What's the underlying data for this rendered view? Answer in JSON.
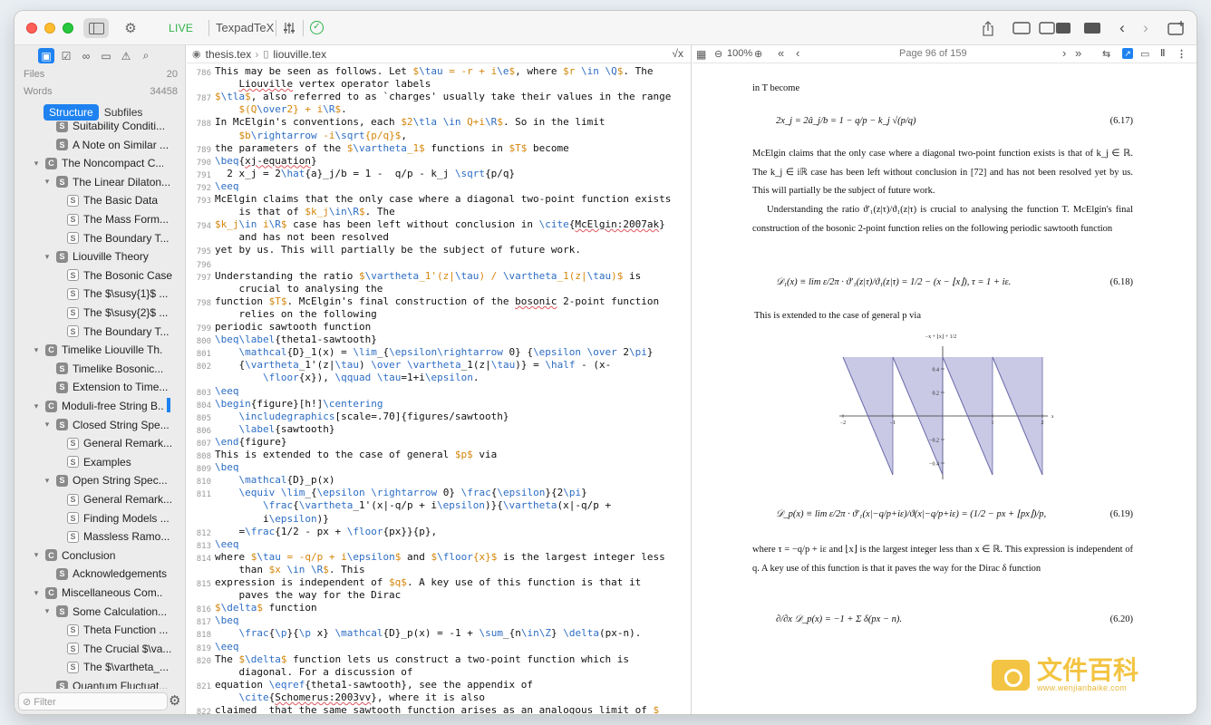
{
  "toolbar": {
    "live_label": "LIVE",
    "project_name": "TexpadTeX",
    "sidebar_toggle_icon": "sidebar-icon",
    "settings_icon": "gear-cluster-icon",
    "mixer_icon": "sliders-icon",
    "status_icon": "checkmark-circle-icon",
    "share_icon": "share-icon",
    "layout_icons": [
      "editor-only-icon",
      "split-view-icon",
      "preview-only-icon"
    ],
    "nav_back_icon": "chevron-left-icon",
    "nav_forward_icon": "chevron-right-icon",
    "new_window_icon": "new-window-icon"
  },
  "sidebar": {
    "files_label": "Files",
    "files_count": "20",
    "words_label": "Words",
    "words_count": "34458",
    "tabs": [
      "Structure",
      "Subfiles"
    ],
    "active_tab": "Structure",
    "filter_placeholder": "Filter",
    "tree": [
      {
        "label": "Suitability Conditi...",
        "badge": "S",
        "level": 2,
        "chev": "",
        "sub": false
      },
      {
        "label": "A Note on Similar ...",
        "badge": "S",
        "level": 2,
        "chev": "",
        "sub": false
      },
      {
        "label": "The Noncompact C...",
        "badge": "C",
        "level": 1,
        "chev": "▾",
        "sub": false
      },
      {
        "label": "The Linear Dilaton...",
        "badge": "S",
        "level": 2,
        "chev": "▾",
        "sub": false
      },
      {
        "label": "The Basic Data",
        "badge": "S",
        "level": 3,
        "chev": "",
        "sub": true
      },
      {
        "label": "The Mass Form...",
        "badge": "S",
        "level": 3,
        "chev": "",
        "sub": true
      },
      {
        "label": "The Boundary T...",
        "badge": "S",
        "level": 3,
        "chev": "",
        "sub": true
      },
      {
        "label": "Liouville Theory",
        "badge": "S",
        "level": 2,
        "chev": "▾",
        "sub": false
      },
      {
        "label": "The Bosonic Case",
        "badge": "S",
        "level": 3,
        "chev": "",
        "sub": true
      },
      {
        "label": "The $\\susy{1}$ ...",
        "badge": "S",
        "level": 3,
        "chev": "",
        "sub": true
      },
      {
        "label": "The $\\susy{2}$ ...",
        "badge": "S",
        "level": 3,
        "chev": "",
        "sub": true
      },
      {
        "label": "The Boundary T...",
        "badge": "S",
        "level": 3,
        "chev": "",
        "sub": true
      },
      {
        "label": "Timelike Liouville Th...",
        "badge": "C",
        "level": 1,
        "chev": "▾",
        "sub": false
      },
      {
        "label": "Timelike Bosonic...",
        "badge": "S",
        "level": 2,
        "chev": "",
        "sub": false
      },
      {
        "label": "Extension to Time...",
        "badge": "S",
        "level": 2,
        "chev": "",
        "sub": false
      },
      {
        "label": "Moduli-free String B...",
        "badge": "C",
        "level": 1,
        "chev": "▾",
        "sub": false
      },
      {
        "label": "Closed String Spe...",
        "badge": "S",
        "level": 2,
        "chev": "▾",
        "sub": false
      },
      {
        "label": "General Remark...",
        "badge": "S",
        "level": 3,
        "chev": "",
        "sub": true
      },
      {
        "label": "Examples",
        "badge": "S",
        "level": 3,
        "chev": "",
        "sub": true
      },
      {
        "label": "Open String Spec...",
        "badge": "S",
        "level": 2,
        "chev": "▾",
        "sub": false
      },
      {
        "label": "General Remark...",
        "badge": "S",
        "level": 3,
        "chev": "",
        "sub": true
      },
      {
        "label": "Finding Models ...",
        "badge": "S",
        "level": 3,
        "chev": "",
        "sub": true
      },
      {
        "label": "Massless Ramo...",
        "badge": "S",
        "level": 3,
        "chev": "",
        "sub": true
      },
      {
        "label": "Conclusion",
        "badge": "C",
        "level": 1,
        "chev": "▾",
        "sub": false
      },
      {
        "label": "Acknowledgements",
        "badge": "S",
        "level": 2,
        "chev": "",
        "sub": false
      },
      {
        "label": "Miscellaneous Com...",
        "badge": "C",
        "level": 1,
        "chev": "▾",
        "sub": false
      },
      {
        "label": "Some Calculation...",
        "badge": "S",
        "level": 2,
        "chev": "▾",
        "sub": false
      },
      {
        "label": "Theta Function ...",
        "badge": "S",
        "level": 3,
        "chev": "",
        "sub": true
      },
      {
        "label": "The Crucial $\\va...",
        "badge": "S",
        "level": 3,
        "chev": "",
        "sub": true
      },
      {
        "label": "The $\\vartheta_...",
        "badge": "S",
        "level": 3,
        "chev": "",
        "sub": true
      },
      {
        "label": "Quantum Fluctuat...",
        "badge": "S",
        "level": 2,
        "chev": "",
        "sub": false
      }
    ]
  },
  "editor": {
    "breadcrumb": [
      "thesis.tex",
      "liouville.tex"
    ],
    "math_button": "√x",
    "lines": [
      {
        "n": "786",
        "t": "This may be seen as follows. Let $\\tau = -r + i\\e$, where $r \\in \\Q$. The"
      },
      {
        "n": "",
        "t": "    Liouville vertex operator labels"
      },
      {
        "n": "787",
        "t": "$\\tla$, also referred to as `charges' usually take their values in the range"
      },
      {
        "n": "",
        "t": "    $(Q\\over2} + i\\R$."
      },
      {
        "n": "788",
        "t": "In McElgin's conventions, each $2\\tla \\in Q+i\\R$. So in the limit"
      },
      {
        "n": "",
        "t": "    $b\\rightarrow -i\\sqrt{p/q}$,"
      },
      {
        "n": "789",
        "t": "the parameters of the $\\vartheta_1$ functions in $T$ become"
      },
      {
        "n": "790",
        "t": "\\beq{xj-equation}"
      },
      {
        "n": "791",
        "t": "  2 x_j = 2\\hat{a}_j/b = 1 -  q/p - k_j \\sqrt{p/q}"
      },
      {
        "n": "792",
        "t": "\\eeq"
      },
      {
        "n": "793",
        "t": "McElgin claims that the only case where a diagonal two-point function exists"
      },
      {
        "n": "",
        "t": "    is that of $k_j\\in\\R$. The"
      },
      {
        "n": "794",
        "t": "$k_j\\in i\\R$ case has been left without conclusion in \\cite{McElgin:2007ak}"
      },
      {
        "n": "",
        "t": "    and has not been resolved"
      },
      {
        "n": "795",
        "t": "yet by us. This will partially be the subject of future work."
      },
      {
        "n": "796",
        "t": ""
      },
      {
        "n": "797",
        "t": "Understanding the ratio $\\vartheta_1'(z|\\tau) / \\vartheta_1(z|\\tau)$ is"
      },
      {
        "n": "",
        "t": "    crucial to analysing the"
      },
      {
        "n": "798",
        "t": "function $T$. McElgin's final construction of the bosonic 2-point function"
      },
      {
        "n": "",
        "t": "    relies on the following"
      },
      {
        "n": "799",
        "t": "periodic sawtooth function"
      },
      {
        "n": "800",
        "t": "\\beq\\label{theta1-sawtooth}"
      },
      {
        "n": "801",
        "t": "    \\mathcal{D}_1(x) = \\lim_{\\epsilon\\rightarrow 0} {\\epsilon \\over 2\\pi}"
      },
      {
        "n": "802",
        "t": "    {\\vartheta_1'(z|\\tau) \\over \\vartheta_1(z|\\tau)} = \\half - (x-"
      },
      {
        "n": "",
        "t": "        \\floor{x}), \\qquad \\tau=1+i\\epsilon."
      },
      {
        "n": "803",
        "t": "\\eeq"
      },
      {
        "n": "804",
        "t": "\\begin{figure}[h!]\\centering"
      },
      {
        "n": "805",
        "t": "    \\includegraphics[scale=.70]{figures/sawtooth}"
      },
      {
        "n": "806",
        "t": "    \\label{sawtooth}"
      },
      {
        "n": "807",
        "t": "\\end{figure}"
      },
      {
        "n": "808",
        "t": "This is extended to the case of general $p$ via"
      },
      {
        "n": "809",
        "t": "\\beq"
      },
      {
        "n": "810",
        "t": "    \\mathcal{D}_p(x)"
      },
      {
        "n": "811",
        "t": "    \\equiv \\lim_{\\epsilon \\rightarrow 0} \\frac{\\epsilon}{2\\pi}"
      },
      {
        "n": "",
        "t": "        \\frac{\\vartheta_1'(x|-q/p + i\\epsilon)}{\\vartheta(x|-q/p +"
      },
      {
        "n": "",
        "t": "        i\\epsilon)}"
      },
      {
        "n": "812",
        "t": "    =\\frac{1/2 - px + \\floor{px}}{p},"
      },
      {
        "n": "813",
        "t": "\\eeq"
      },
      {
        "n": "814",
        "t": "where $\\tau = -q/p + i\\epsilon$ and $\\floor{x}$ is the largest integer less"
      },
      {
        "n": "",
        "t": "    than $x \\in \\R$. This"
      },
      {
        "n": "815",
        "t": "expression is independent of $q$. A key use of this function is that it"
      },
      {
        "n": "",
        "t": "    paves the way for the Dirac"
      },
      {
        "n": "816",
        "t": "$\\delta$ function"
      },
      {
        "n": "817",
        "t": "\\beq"
      },
      {
        "n": "818",
        "t": "    \\frac{\\p}{\\p x} \\mathcal{D}_p(x) = -1 + \\sum_{n\\in\\Z} \\delta(px-n)."
      },
      {
        "n": "819",
        "t": "\\eeq"
      },
      {
        "n": "820",
        "t": "The $\\delta$ function lets us construct a two-point function which is"
      },
      {
        "n": "",
        "t": "    diagonal. For a discussion of"
      },
      {
        "n": "821",
        "t": "equation \\eqref{theta1-sawtooth}, see the appendix of"
      },
      {
        "n": "",
        "t": "    \\cite{Schomerus:2003vv}, where it is also"
      },
      {
        "n": "822",
        "t": "claimed  that the same sawtooth function arises as an analogous limit of $"
      }
    ]
  },
  "preview": {
    "zoom": "100%",
    "page_label": "Page 96 of 159",
    "text": {
      "p0": "in T become",
      "eq617": "2x_j = 2â_j/b = 1 − q/p − k_j √(p/q)",
      "n617": "(6.17)",
      "p1": "McElgin claims that the only case where a diagonal two-point function exists is that of k_j ∈ ℝ. The k_j ∈ iℝ case has been left without conclusion in [72] and has not been resolved yet by us. This will partially be the subject of future work.",
      "p2": "Understanding the ratio ϑ′₁(z|τ)/ϑ₁(z|τ) is crucial to analysing the function T. McElgin's final construction of the bosonic 2-point function relies on the following periodic sawtooth function",
      "eq618": "𝒟₁(x) ≡ lim ε/2π · ϑ′₁(z|τ)/ϑ₁(z|τ) = 1/2 − (x − ⌊x⌋),     τ = 1 + iε.",
      "n618": "(6.18)",
      "p3": "This is extended to the case of general p via",
      "eq619": "𝒟_p(x) ≡ lim ε/2π · ϑ′₁(x|−q/p+iε)/ϑ(x|−q/p+iε) = (1/2 − px + ⌊px⌋)/p,",
      "n619": "(6.19)",
      "p4": "where τ = −q/p + iε and ⌊x⌋ is the largest integer less than x ∈ ℝ. This expression is independent of q. A key use of this function is that it paves the way for the Dirac δ function",
      "eq620": "∂/∂x 𝒟_p(x) = −1 + Σ δ(px − n).",
      "n620": "(6.20)"
    },
    "plot": {
      "formula": "−x + ⌊x⌋ + 1/2",
      "yticks": [
        "0.4",
        "0.2",
        "−0.2",
        "−0.4"
      ],
      "xticks": [
        "−2",
        "−1",
        "1",
        "2"
      ],
      "xvar": "x"
    }
  },
  "watermark": {
    "title": "文件百科",
    "subtitle": "www.wenjianbaike.com"
  }
}
